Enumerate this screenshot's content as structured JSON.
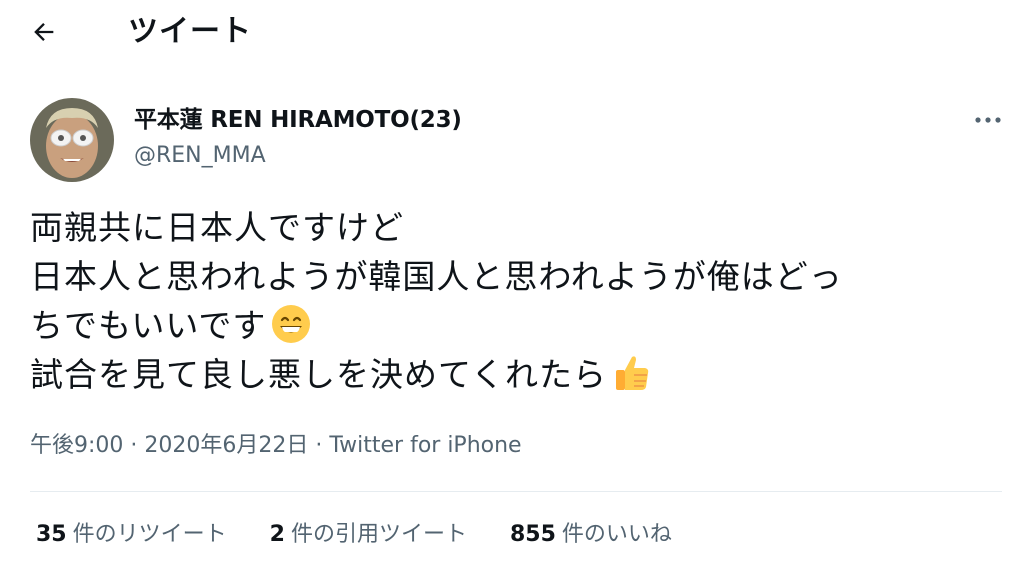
{
  "header": {
    "title": "ツイート"
  },
  "tweet": {
    "author": {
      "name": "平本蓮 REN HIRAMOTO(23)",
      "handle": "@REN_MMA"
    },
    "lines": [
      "両親共に日本人ですけど",
      "日本人と思われようが韓国人と思われようが俺はどっ",
      "ちでもいいです",
      "試合を見て良し悪しを決めてくれたら"
    ],
    "emojis": [
      "grinning-face-emoji",
      "thumbs-up-emoji"
    ],
    "meta": "午後9:00 · 2020年6月22日 · Twitter for iPhone"
  },
  "stats": {
    "retweets": {
      "count": "35",
      "label": "件のリツイート"
    },
    "quotes": {
      "count": "2",
      "label": "件の引用ツイート"
    },
    "likes": {
      "count": "855",
      "label": "件のいいね"
    }
  },
  "colors": {
    "text": "#0f1419",
    "secondary": "#536471",
    "divider": "#e6ecf0"
  }
}
